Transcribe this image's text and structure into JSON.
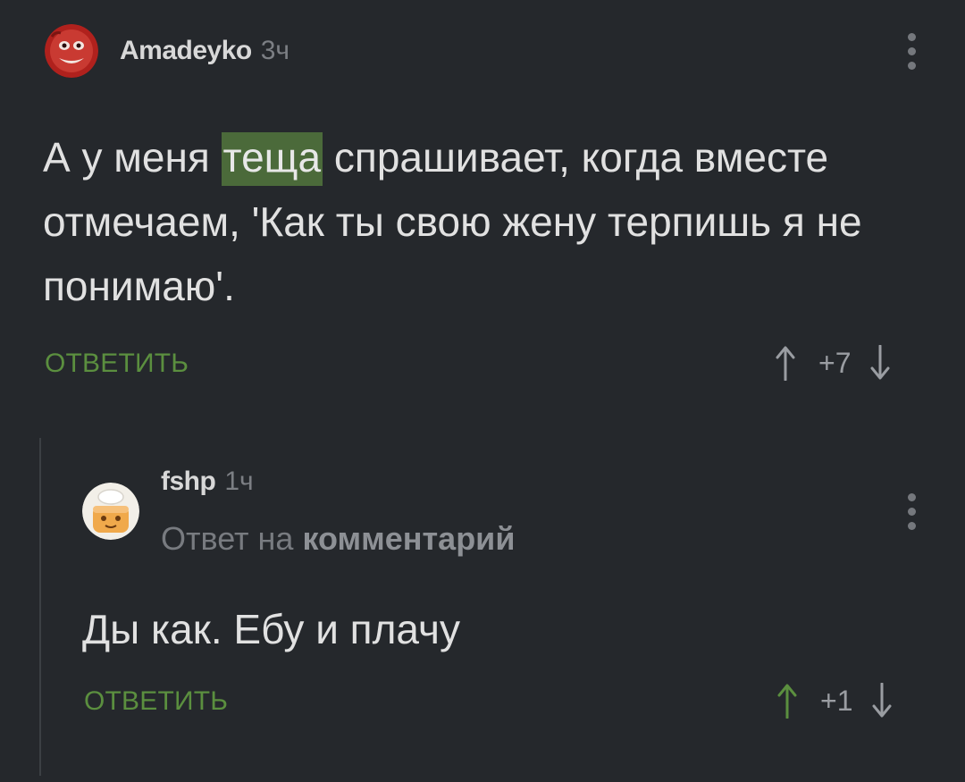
{
  "comments": [
    {
      "username": "Amadeyko",
      "time": "3ч",
      "text_before": "А у меня ",
      "text_highlight": "теща",
      "text_after": " спрашивает, когда вместе отмечаем, 'Как ты свою жену терпишь я не понимаю'.",
      "reply_label": "ОТВЕТИТЬ",
      "rating": "+7"
    },
    {
      "username": "fshp",
      "time": "1ч",
      "reply_to_prefix": "Ответ на",
      "reply_to_link": "комментарий",
      "text": "Ды как. Ебу и плачу",
      "reply_label": "ОТВЕТИТЬ",
      "rating": "+1"
    }
  ],
  "colors": {
    "background": "#25282c",
    "accent_green": "#5b8f3f",
    "highlight": "#4b6a3a",
    "muted": "#7c7f84"
  },
  "icons": {
    "menu": "more-vertical-icon",
    "upvote": "arrow-up-icon",
    "downvote": "arrow-down-icon"
  }
}
